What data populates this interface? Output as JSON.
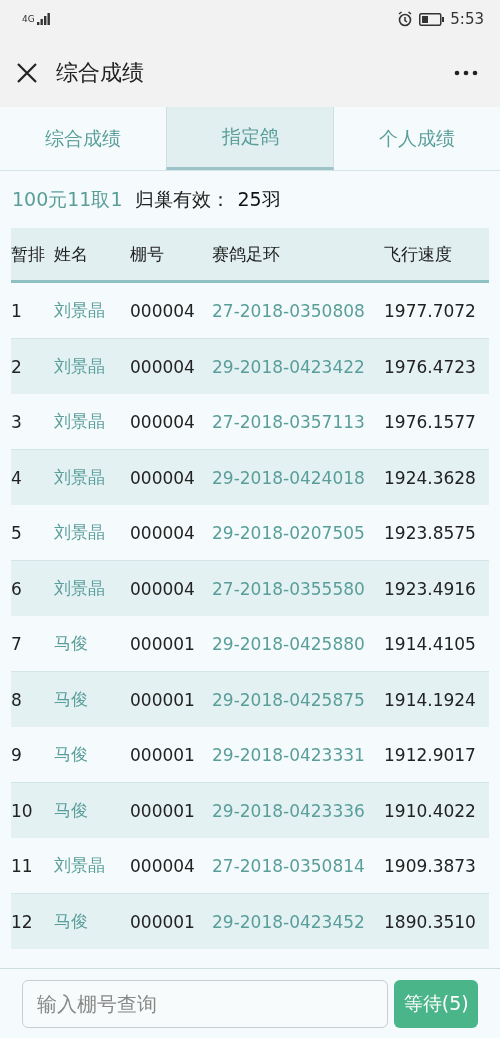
{
  "status_bar": {
    "network": "4G",
    "time": "5:53"
  },
  "title_bar": {
    "title": "综合成绩"
  },
  "tabs": [
    {
      "label": "综合成绩",
      "selected": false
    },
    {
      "label": "指定鸽",
      "selected": true
    },
    {
      "label": "个人成绩",
      "selected": false
    }
  ],
  "summary": {
    "race": "100元11取1",
    "label": "归巢有效：",
    "count": "25羽"
  },
  "table": {
    "columns": [
      "暂排",
      "姓名",
      "棚号",
      "赛鸽足环",
      "飞行速度"
    ],
    "rows": [
      [
        "1",
        "刘景晶",
        "000004",
        "27-2018-0350808",
        "1977.7072"
      ],
      [
        "2",
        "刘景晶",
        "000004",
        "29-2018-0423422",
        "1976.4723"
      ],
      [
        "3",
        "刘景晶",
        "000004",
        "27-2018-0357113",
        "1976.1577"
      ],
      [
        "4",
        "刘景晶",
        "000004",
        "29-2018-0424018",
        "1924.3628"
      ],
      [
        "5",
        "刘景晶",
        "000004",
        "29-2018-0207505",
        "1923.8575"
      ],
      [
        "6",
        "刘景晶",
        "000004",
        "27-2018-0355580",
        "1923.4916"
      ],
      [
        "7",
        "马俊",
        "000001",
        "29-2018-0425880",
        "1914.4105"
      ],
      [
        "8",
        "马俊",
        "000001",
        "29-2018-0425875",
        "1914.1924"
      ],
      [
        "9",
        "马俊",
        "000001",
        "29-2018-0423331",
        "1912.9017"
      ],
      [
        "10",
        "马俊",
        "000001",
        "29-2018-0423336",
        "1910.4022"
      ],
      [
        "11",
        "刘景晶",
        "000004",
        "27-2018-0350814",
        "1909.3873"
      ],
      [
        "12",
        "马俊",
        "000001",
        "29-2018-0423452",
        "1890.3510"
      ]
    ]
  },
  "search": {
    "placeholder": "输入棚号查询",
    "button": "等待(5)"
  }
}
